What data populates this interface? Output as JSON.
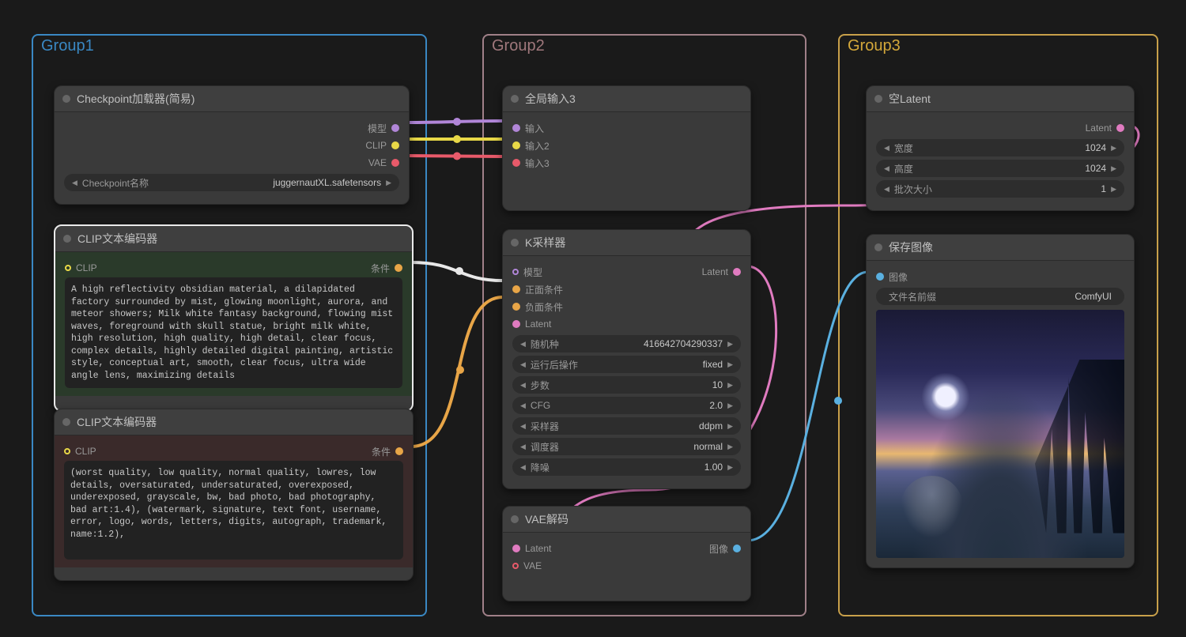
{
  "groups": {
    "g1": {
      "title": "Group1"
    },
    "g2": {
      "title": "Group2"
    },
    "g3": {
      "title": "Group3"
    }
  },
  "checkpoint_loader": {
    "title": "Checkpoint加载器(简易)",
    "outputs": {
      "model": "模型",
      "clip": "CLIP",
      "vae": "VAE"
    },
    "widget_label": "Checkpoint名称",
    "widget_value": "juggernautXL.safetensors"
  },
  "clip_pos": {
    "title": "CLIP文本编码器",
    "input": "CLIP",
    "output": "条件",
    "text": "A high reflectivity obsidian material, a dilapidated factory surrounded by mist, glowing moonlight, aurora, and meteor showers; Milk white fantasy background, flowing mist waves, foreground with skull statue, bright milk white, high resolution, high quality, high detail, clear focus, complex details, highly detailed digital painting, artistic style, conceptual art, smooth, clear focus, ultra wide angle lens, maximizing details"
  },
  "clip_neg": {
    "title": "CLIP文本编码器",
    "input": "CLIP",
    "output": "条件",
    "text": "(worst quality, low quality, normal quality, lowres, low details, oversaturated, undersaturated, overexposed, underexposed, grayscale, bw, bad photo, bad photography, bad art:1.4), (watermark, signature, text font, username, error, logo, words, letters, digits, autograph, trademark, name:1.2),"
  },
  "global_in": {
    "title": "全局输入3",
    "in1": "输入",
    "in2": "输入2",
    "in3": "输入3"
  },
  "ksampler": {
    "title": "K采样器",
    "inputs": {
      "model": "模型",
      "pos": "正面条件",
      "neg": "负面条件",
      "latent": "Latent"
    },
    "output": "Latent",
    "params": [
      {
        "label": "随机种",
        "value": "416642704290337"
      },
      {
        "label": "运行后操作",
        "value": "fixed"
      },
      {
        "label": "步数",
        "value": "10"
      },
      {
        "label": "CFG",
        "value": "2.0"
      },
      {
        "label": "采样器",
        "value": "ddpm"
      },
      {
        "label": "调度器",
        "value": "normal"
      },
      {
        "label": "降噪",
        "value": "1.00"
      }
    ]
  },
  "vae_decode": {
    "title": "VAE解码",
    "in_latent": "Latent",
    "in_vae": "VAE",
    "out_image": "图像"
  },
  "empty_latent": {
    "title": "空Latent",
    "output": "Latent",
    "params": [
      {
        "label": "宽度",
        "value": "1024"
      },
      {
        "label": "高度",
        "value": "1024"
      },
      {
        "label": "批次大小",
        "value": "1"
      }
    ]
  },
  "save_image": {
    "title": "保存图像",
    "input": "图像",
    "param_label": "文件名前缀",
    "param_value": "ComfyUI"
  }
}
